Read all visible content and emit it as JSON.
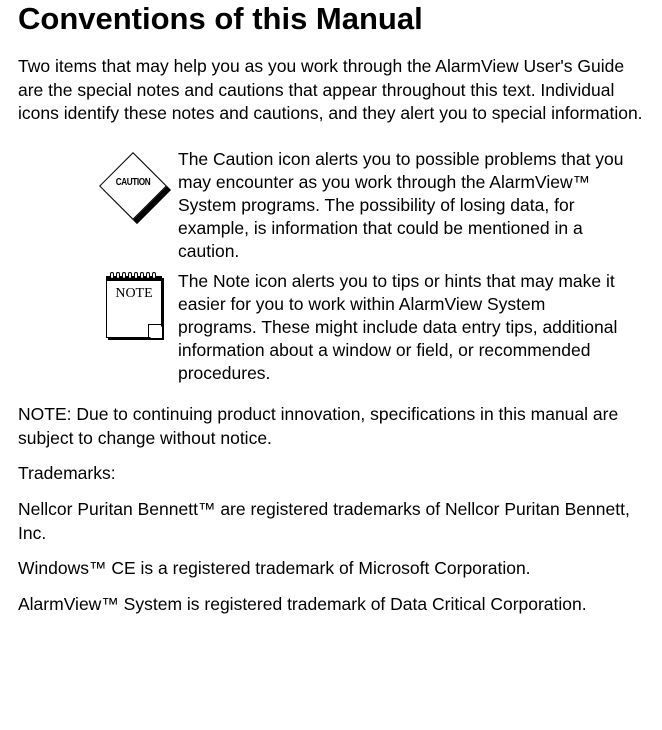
{
  "heading": "Conventions of this Manual",
  "intro": "Two items that may help you as you work through the AlarmView User's Guide are the special notes and cautions that appear throughout this text.  Individual icons identify these notes and cautions, and they alert you to special information.",
  "sections": [
    {
      "icon_label": "CAUTION",
      "text": "The Caution icon alerts you to possible problems that you may encounter as you work through the AlarmView™ System programs.  The possibility of losing data, for example, is information that could be mentioned in a caution."
    },
    {
      "icon_label": "NOTE",
      "text": "The Note icon alerts you to tips or hints that may make it easier for you to work within AlarmView System programs.  These might include data entry tips, additional information about a window or field, or recommended procedures."
    }
  ],
  "paragraphs": [
    "NOTE: Due to continuing product innovation, specifications in this manual are subject to change without notice.",
    "Trademarks:",
    "Nellcor Puritan Bennett™ are registered trademarks of Nellcor Puritan Bennett, Inc.",
    "Windows™ CE is a registered trademark of Microsoft Corporation.",
    "AlarmView™ System is registered trademark of Data Critical Corporation."
  ]
}
